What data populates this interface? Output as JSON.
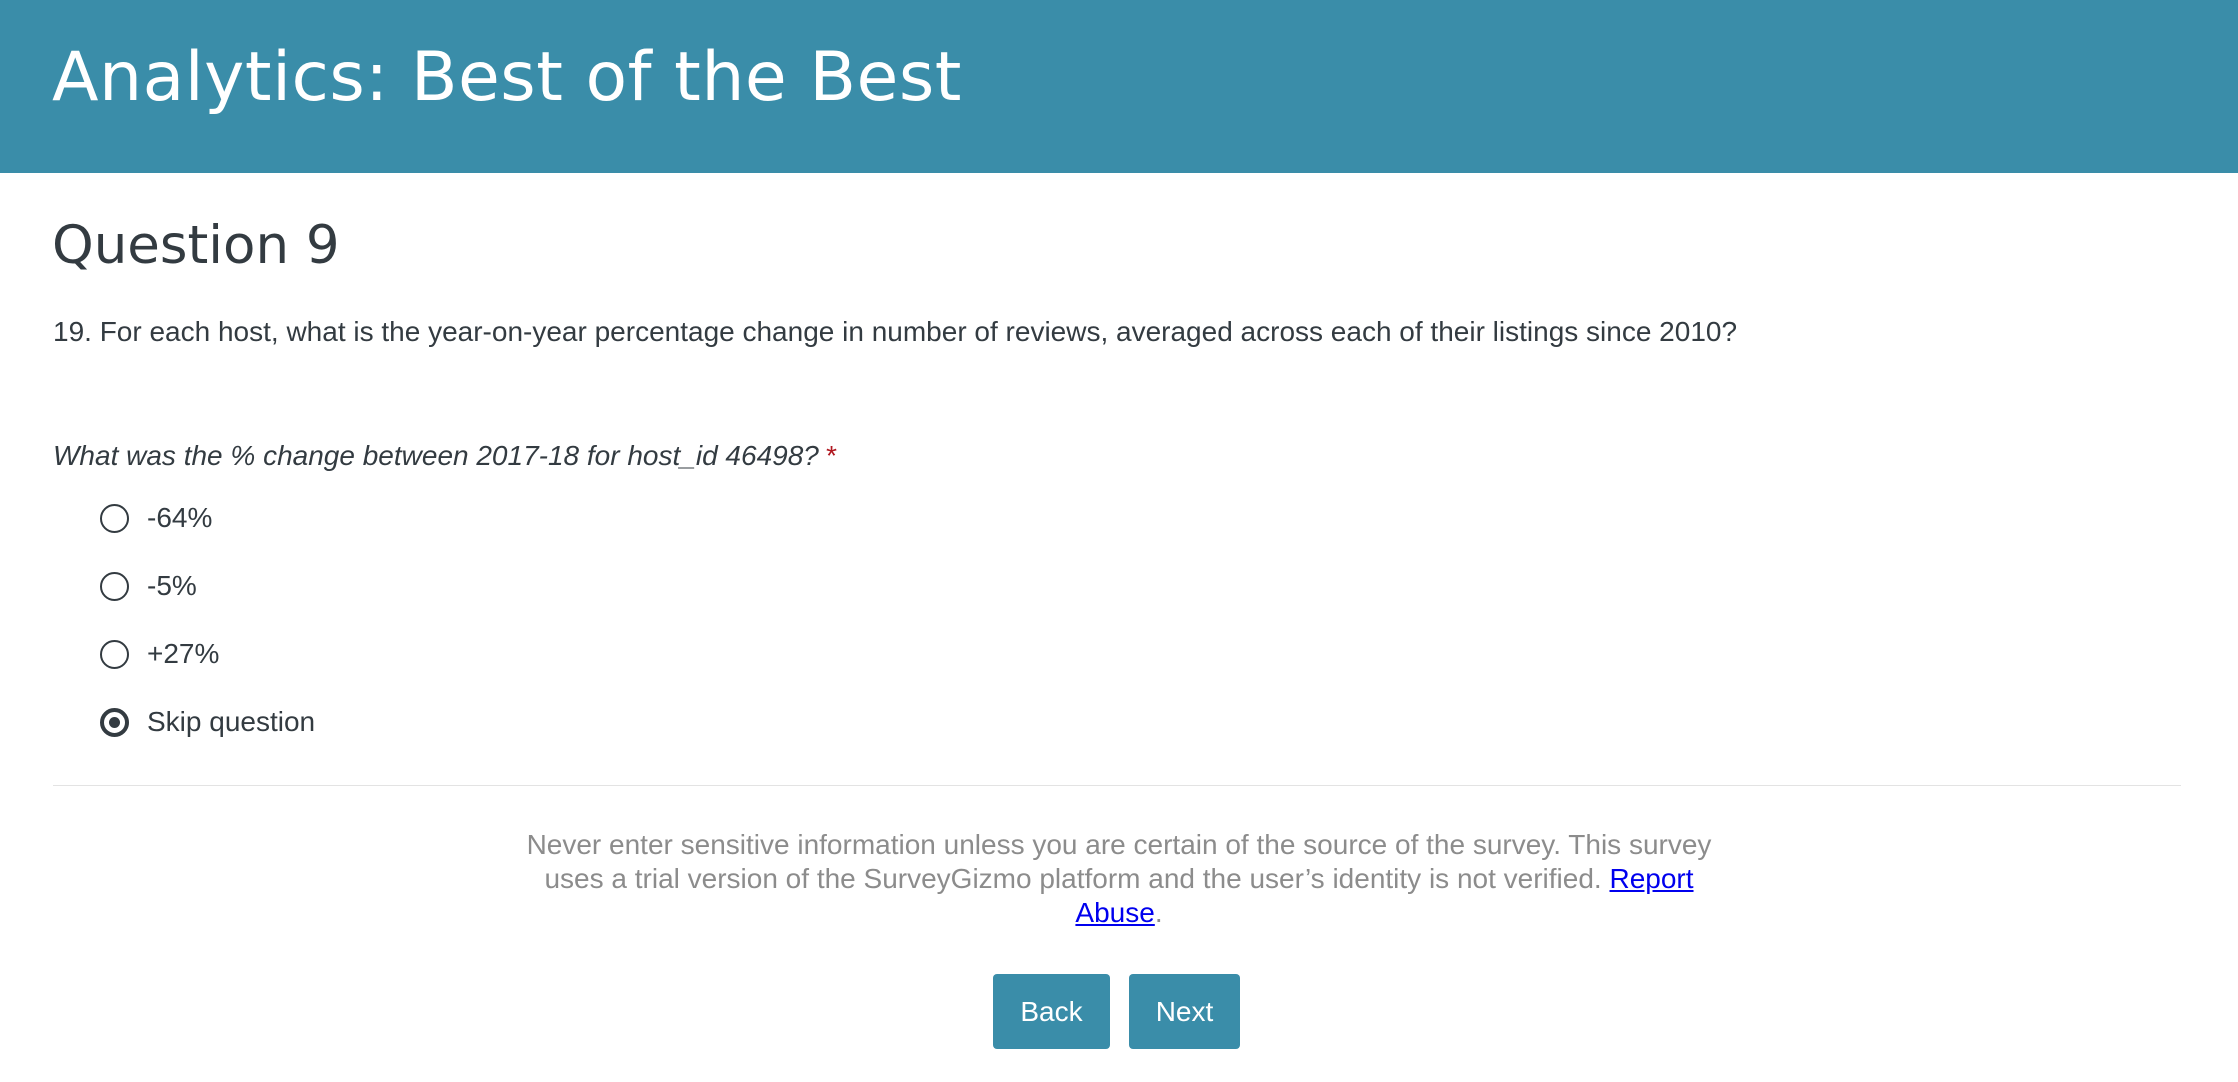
{
  "header": {
    "title": "Analytics: Best of the Best",
    "background_color": "#3a8da9"
  },
  "page": {
    "title": "Question 9"
  },
  "question": {
    "text": "19. For each host, what is the year-on-year percentage change in number of reviews, averaged across each of their listings since 2010?",
    "sub_question": "What was the % change between 2017-18 for host_id 46498?",
    "required_marker": "*",
    "options": [
      {
        "label": "-64%",
        "selected": false
      },
      {
        "label": "-5%",
        "selected": false
      },
      {
        "label": "+27%",
        "selected": false
      },
      {
        "label": "Skip question",
        "selected": true
      }
    ]
  },
  "footer": {
    "notice_text": "Never enter sensitive information unless you are certain of the source of the survey. This survey uses a trial version of the SurveyGizmo platform and the user’s identity is not verified.",
    "report_link": "Report Abuse",
    "notice_end": "."
  },
  "nav": {
    "back_label": "Back",
    "next_label": "Next"
  }
}
